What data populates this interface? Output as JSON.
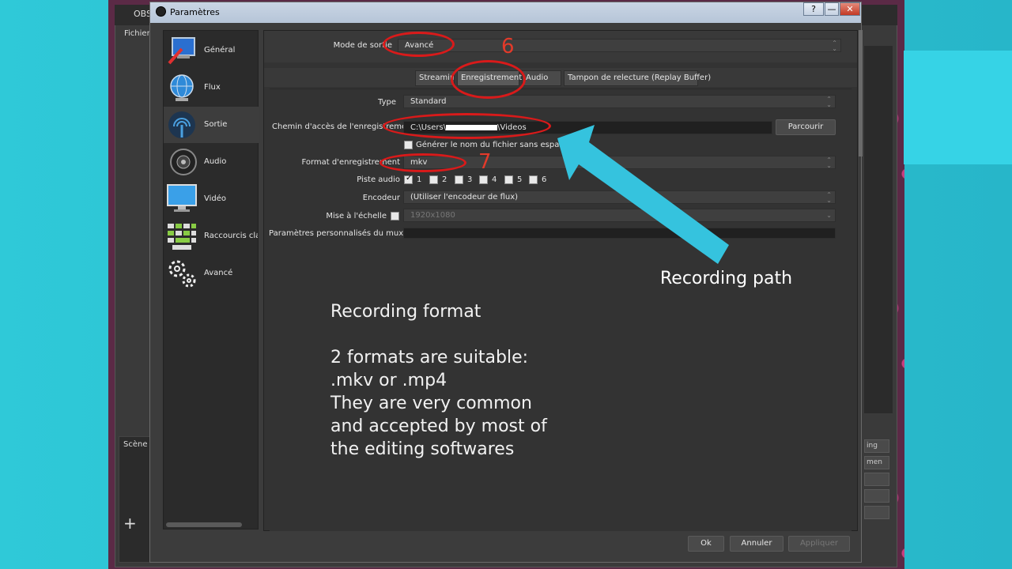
{
  "background": {
    "app_title": "OBS",
    "menu_label": "Fichier",
    "scene_label": "Scène",
    "plus_symbol": "+",
    "right_buttons": [
      "ing",
      "men",
      "",
      "",
      ""
    ]
  },
  "dialog": {
    "title": "Paramètres",
    "window_buttons": [
      "?",
      "—",
      "✕"
    ]
  },
  "sidebar": {
    "items": [
      {
        "label": "Général",
        "icon": "general-icon"
      },
      {
        "label": "Flux",
        "icon": "globe-icon"
      },
      {
        "label": "Sortie",
        "icon": "output-icon"
      },
      {
        "label": "Audio",
        "icon": "speaker-icon"
      },
      {
        "label": "Vidéo",
        "icon": "monitor-icon"
      },
      {
        "label": "Raccourcis cla",
        "icon": "keyboard-icon"
      },
      {
        "label": "Avancé",
        "icon": "gears-icon"
      }
    ],
    "active_index": 2
  },
  "output_mode": {
    "label": "Mode de sortie",
    "value": "Avancé"
  },
  "tabs": [
    "Streaming",
    "Enregistrement",
    "Audio",
    "Tampon de relecture (Replay Buffer)"
  ],
  "active_tab": "Enregistrement",
  "form": {
    "type": {
      "label": "Type",
      "value": "Standard"
    },
    "path": {
      "label": "Chemin d'accès de l'enregistrement",
      "value_start": "C:\\Users\\",
      "value_end": "\\Videos",
      "browse": "Parcourir"
    },
    "no_space": {
      "label": "Générer le nom du fichier sans espace",
      "checked": false
    },
    "format": {
      "label": "Format d'enregistrement",
      "value": "mkv"
    },
    "tracks": {
      "label": "Piste audio",
      "items": [
        {
          "n": "1",
          "checked": true
        },
        {
          "n": "2",
          "checked": false
        },
        {
          "n": "3",
          "checked": false
        },
        {
          "n": "4",
          "checked": false
        },
        {
          "n": "5",
          "checked": false
        },
        {
          "n": "6",
          "checked": false
        }
      ]
    },
    "encoder": {
      "label": "Encodeur",
      "value": "(Utiliser l'encodeur de flux)"
    },
    "rescale": {
      "label": "Mise à l'échelle",
      "value": "1920x1080",
      "checked": false
    },
    "muxer": {
      "label": "Paramètres personnalisés du muxer",
      "value": ""
    }
  },
  "footer": {
    "ok": "Ok",
    "cancel": "Annuler",
    "apply": "Appliquer"
  },
  "annotations": {
    "num6": "6",
    "num7": "7",
    "recording_path": "Recording path",
    "format_lines": [
      "Recording format",
      "",
      "2 formats are suitable:",
      ".mkv or .mp4",
      "They are very common",
      "and accepted by most of",
      "the editing softwares"
    ]
  },
  "colors": {
    "annotation_red": "#d91a1a",
    "arrow_cyan": "#35c3de",
    "accent_cyan": "#36d3e6"
  }
}
